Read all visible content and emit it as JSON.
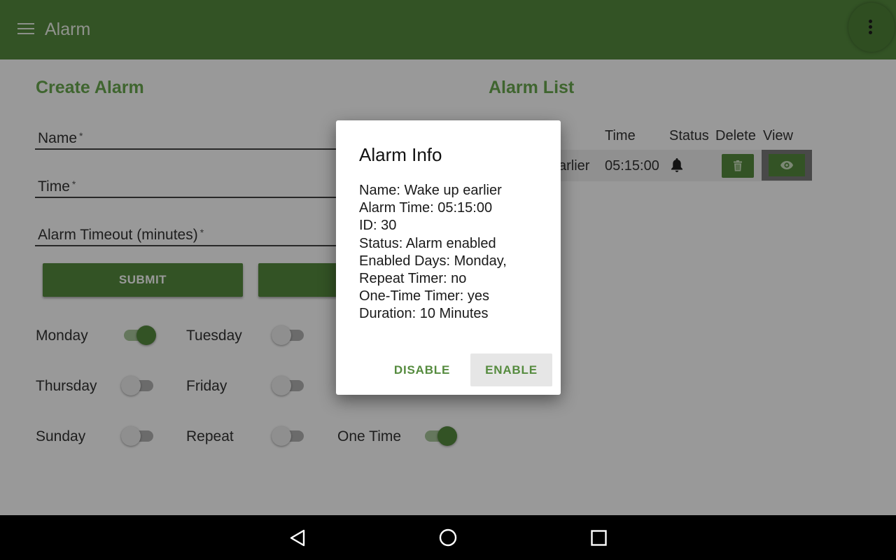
{
  "appbar": {
    "title": "Alarm"
  },
  "create_alarm": {
    "title": "Create Alarm",
    "fields": [
      {
        "label": "Name",
        "required_mark": "*"
      },
      {
        "label": "Time",
        "required_mark": "*"
      },
      {
        "label": "Alarm Timeout (minutes)",
        "required_mark": "*"
      }
    ],
    "submit_label": "SUBMIT",
    "toggles": [
      {
        "label": "Monday",
        "on": true
      },
      {
        "label": "Tuesday",
        "on": false
      },
      {
        "label": "Thursday",
        "on": false
      },
      {
        "label": "Friday",
        "on": false
      },
      {
        "label": "Sunday",
        "on": false
      },
      {
        "label": "Repeat",
        "on": false
      },
      {
        "label": "One Time",
        "on": true
      }
    ]
  },
  "alarm_list": {
    "title": "Alarm List",
    "columns": [
      "Time",
      "Status",
      "Delete",
      "View"
    ],
    "rows": [
      {
        "name_visible": "arlier",
        "time": "05:15:00",
        "status_icon": "bell-icon",
        "delete_icon": "trash-icon",
        "view_icon": "eye-icon"
      }
    ]
  },
  "dialog": {
    "title": "Alarm Info",
    "lines": [
      "Name: Wake up earlier",
      "Alarm Time: 05:15:00",
      "ID: 30",
      "Status: Alarm enabled",
      "Enabled Days: Monday,",
      "Repeat Timer: no",
      "One-Time Timer: yes",
      "Duration: 10 Minutes"
    ],
    "disable_label": "DISABLE",
    "enable_label": "ENABLE"
  },
  "navbar": {
    "icons": [
      "back-icon",
      "home-icon",
      "recents-icon"
    ]
  },
  "colors": {
    "primary": "#558b3e",
    "accent": "#6aa84f",
    "scrim": "rgba(0,0,0,0.4)"
  }
}
